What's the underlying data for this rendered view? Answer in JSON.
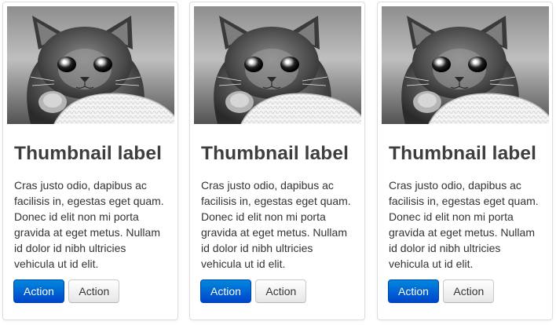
{
  "thumbnails": [
    {
      "image": "kitten-photo",
      "label": "Thumbnail label",
      "text": "Cras justo odio, dapibus ac facilisis in, egestas eget quam. Donec id elit non mi porta gravida at eget metus. Nullam id dolor id nibh ultricies vehicula ut id elit.",
      "primary_button": "Action",
      "secondary_button": "Action"
    },
    {
      "image": "kitten-photo",
      "label": "Thumbnail label",
      "text": "Cras justo odio, dapibus ac facilisis in, egestas eget quam. Donec id elit non mi porta gravida at eget metus. Nullam id dolor id nibh ultricies vehicula ut id elit.",
      "primary_button": "Action",
      "secondary_button": "Action"
    },
    {
      "image": "kitten-photo",
      "label": "Thumbnail label",
      "text": "Cras justo odio, dapibus ac facilisis in, egestas eget quam. Donec id elit non mi porta gravida at eget metus. Nullam id dolor id nibh ultricies vehicula ut id elit.",
      "primary_button": "Action",
      "secondary_button": "Action"
    }
  ],
  "colors": {
    "primary_button": "#0055cc",
    "heading": "#3e3e3e",
    "border": "#dddddd"
  }
}
